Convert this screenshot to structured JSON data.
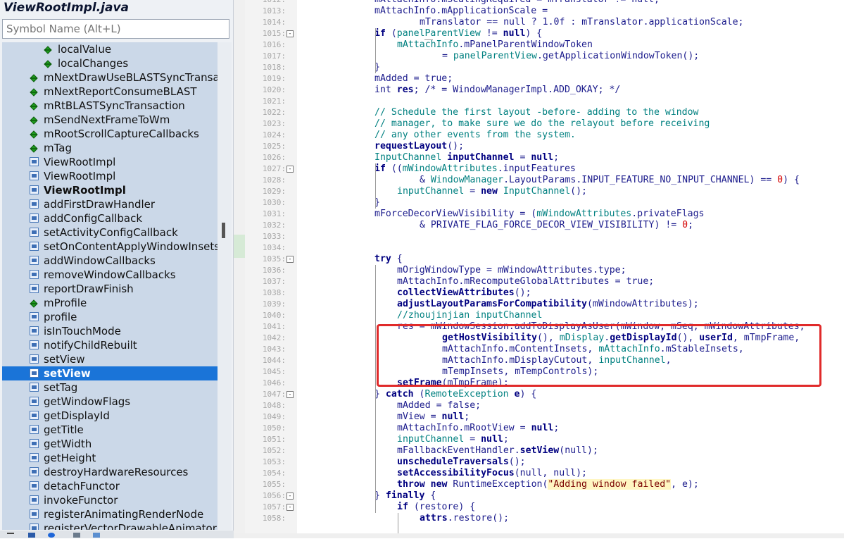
{
  "file_title": "ViewRootImpl.java",
  "search": {
    "placeholder": "Symbol Name (Alt+L)"
  },
  "symbols": [
    {
      "label": "localValue",
      "icon": "green",
      "depth": 2
    },
    {
      "label": "localChanges",
      "icon": "green",
      "depth": 2
    },
    {
      "label": "mNextDrawUseBLASTSyncTransaction",
      "icon": "green",
      "depth": 1
    },
    {
      "label": "mNextReportConsumeBLAST",
      "icon": "green",
      "depth": 1
    },
    {
      "label": "mRtBLASTSyncTransaction",
      "icon": "green",
      "depth": 1
    },
    {
      "label": "mSendNextFrameToWm",
      "icon": "green",
      "depth": 1
    },
    {
      "label": "mRootScrollCaptureCallbacks",
      "icon": "green",
      "depth": 1
    },
    {
      "label": "mTag",
      "icon": "green",
      "depth": 1
    },
    {
      "label": "ViewRootImpl",
      "icon": "method",
      "depth": 1
    },
    {
      "label": "ViewRootImpl",
      "icon": "method",
      "depth": 1
    },
    {
      "label": "ViewRootImpl",
      "icon": "method",
      "depth": 1,
      "bold": true
    },
    {
      "label": "addFirstDrawHandler",
      "icon": "method",
      "depth": 1
    },
    {
      "label": "addConfigCallback",
      "icon": "method",
      "depth": 1
    },
    {
      "label": "setActivityConfigCallback",
      "icon": "method",
      "depth": 1
    },
    {
      "label": "setOnContentApplyWindowInsetsListener",
      "icon": "method",
      "depth": 1
    },
    {
      "label": "addWindowCallbacks",
      "icon": "method",
      "depth": 1
    },
    {
      "label": "removeWindowCallbacks",
      "icon": "method",
      "depth": 1
    },
    {
      "label": "reportDrawFinish",
      "icon": "method",
      "depth": 1
    },
    {
      "label": "mProfile",
      "icon": "green",
      "depth": 1
    },
    {
      "label": "profile",
      "icon": "method",
      "depth": 1
    },
    {
      "label": "isInTouchMode",
      "icon": "method",
      "depth": 1
    },
    {
      "label": "notifyChildRebuilt",
      "icon": "method",
      "depth": 1
    },
    {
      "label": "setView",
      "icon": "method",
      "depth": 1
    },
    {
      "label": "setView",
      "icon": "method",
      "depth": 1,
      "selected": true,
      "bold": true
    },
    {
      "label": "setTag",
      "icon": "method",
      "depth": 1
    },
    {
      "label": "getWindowFlags",
      "icon": "method",
      "depth": 1
    },
    {
      "label": "getDisplayId",
      "icon": "method",
      "depth": 1
    },
    {
      "label": "getTitle",
      "icon": "method",
      "depth": 1
    },
    {
      "label": "getWidth",
      "icon": "method",
      "depth": 1
    },
    {
      "label": "getHeight",
      "icon": "method",
      "depth": 1
    },
    {
      "label": "destroyHardwareResources",
      "icon": "method",
      "depth": 1
    },
    {
      "label": "detachFunctor",
      "icon": "method",
      "depth": 1
    },
    {
      "label": "invokeFunctor",
      "icon": "method",
      "depth": 1
    },
    {
      "label": "registerAnimatingRenderNode",
      "icon": "method",
      "depth": 1
    },
    {
      "label": "registerVectorDrawableAnimator",
      "icon": "method",
      "depth": 1
    }
  ],
  "code": [
    {
      "n": "1012:",
      "fold": false,
      "indent": 24,
      "tokens": [
        [
          "p",
          "mAttachInfo.mScalingRequired = mTranslator != null;"
        ]
      ]
    },
    {
      "n": "1013:",
      "fold": false,
      "indent": 24,
      "tokens": [
        [
          "p",
          "mAttachInfo.mApplicationScale ="
        ]
      ]
    },
    {
      "n": "1014:",
      "fold": false,
      "indent": 32,
      "tokens": [
        [
          "p",
          "mTranslator == null ? 1.0f : mTranslator.applicationScale;"
        ]
      ]
    },
    {
      "n": "1015:",
      "fold": true,
      "indent": 24,
      "tokens": [
        [
          "k",
          "if"
        ],
        [
          "p",
          " ("
        ],
        [
          "v",
          "panelParentView"
        ],
        [
          "p",
          " != "
        ],
        [
          "k",
          "null"
        ],
        [
          "p",
          ") {"
        ]
      ]
    },
    {
      "n": "1016:",
      "fold": false,
      "indent": 28,
      "tokens": [
        [
          "v",
          "mAttachInfo"
        ],
        [
          "p",
          ".mPanelParentWindowToken"
        ]
      ]
    },
    {
      "n": "1017:",
      "fold": false,
      "indent": 36,
      "tokens": [
        [
          "p",
          "= "
        ],
        [
          "v",
          "panelParentView"
        ],
        [
          "p",
          ".getApplicationWindowToken();"
        ]
      ]
    },
    {
      "n": "1018:",
      "fold": false,
      "indent": 24,
      "tokens": [
        [
          "p",
          "}"
        ]
      ]
    },
    {
      "n": "1019:",
      "fold": false,
      "indent": 24,
      "tokens": [
        [
          "p",
          "mAdded = true;"
        ]
      ]
    },
    {
      "n": "1020:",
      "fold": false,
      "indent": 24,
      "tokens": [
        [
          "p",
          "int "
        ],
        [
          "k",
          "res"
        ],
        [
          "p",
          "; /* = WindowManagerImpl.ADD_OKAY; */"
        ]
      ]
    },
    {
      "n": "1021:",
      "fold": false,
      "indent": 24,
      "tokens": []
    },
    {
      "n": "1022:",
      "fold": false,
      "indent": 24,
      "tokens": [
        [
          "c",
          "// Schedule the first layout -before- adding to the window"
        ]
      ]
    },
    {
      "n": "1023:",
      "fold": false,
      "indent": 24,
      "tokens": [
        [
          "c",
          "// manager, to make sure we do the relayout before receiving"
        ]
      ]
    },
    {
      "n": "1024:",
      "fold": false,
      "indent": 24,
      "tokens": [
        [
          "c",
          "// any other events from the system."
        ]
      ]
    },
    {
      "n": "1025:",
      "fold": false,
      "indent": 24,
      "tokens": [
        [
          "f",
          "requestLayout"
        ],
        [
          "p",
          "();"
        ]
      ]
    },
    {
      "n": "1026:",
      "fold": false,
      "indent": 24,
      "tokens": [
        [
          "v",
          "InputChannel "
        ],
        [
          "k",
          "inputChannel"
        ],
        [
          "p",
          " = "
        ],
        [
          "k",
          "null"
        ],
        [
          "p",
          ";"
        ]
      ]
    },
    {
      "n": "1027:",
      "fold": true,
      "indent": 24,
      "tokens": [
        [
          "k",
          "if"
        ],
        [
          "p",
          " (("
        ],
        [
          "v",
          "mWindowAttributes"
        ],
        [
          "p",
          ".inputFeatures"
        ]
      ]
    },
    {
      "n": "1028:",
      "fold": false,
      "indent": 32,
      "tokens": [
        [
          "p",
          "& "
        ],
        [
          "v",
          "WindowManager"
        ],
        [
          "p",
          ".LayoutParams.INPUT_FEATURE_NO_INPUT_CHANNEL) == "
        ],
        [
          "n",
          "0"
        ],
        [
          "p",
          ") {"
        ]
      ]
    },
    {
      "n": "1029:",
      "fold": false,
      "indent": 28,
      "tokens": [
        [
          "v",
          "inputChannel"
        ],
        [
          "p",
          " = "
        ],
        [
          "k",
          "new"
        ],
        [
          "p",
          " "
        ],
        [
          "v",
          "InputChannel"
        ],
        [
          "p",
          "();"
        ]
      ]
    },
    {
      "n": "1030:",
      "fold": false,
      "indent": 24,
      "tokens": [
        [
          "p",
          "}"
        ]
      ]
    },
    {
      "n": "1031:",
      "fold": false,
      "indent": 24,
      "tokens": [
        [
          "p",
          "mForceDecorViewVisibility = ("
        ],
        [
          "v",
          "mWindowAttributes"
        ],
        [
          "p",
          ".privateFlags"
        ]
      ]
    },
    {
      "n": "1032:",
      "fold": false,
      "indent": 32,
      "tokens": [
        [
          "p",
          "& PRIVATE_FLAG_FORCE_DECOR_VIEW_VISIBILITY) != "
        ],
        [
          "n",
          "0"
        ],
        [
          "p",
          ";"
        ]
      ]
    },
    {
      "n": "1033:",
      "fold": false,
      "indent": 24,
      "tokens": []
    },
    {
      "n": "1034:",
      "fold": false,
      "indent": 24,
      "tokens": []
    },
    {
      "n": "1035:",
      "fold": true,
      "indent": 24,
      "tokens": [
        [
          "k",
          "try"
        ],
        [
          "p",
          " {"
        ]
      ]
    },
    {
      "n": "1036:",
      "fold": false,
      "indent": 28,
      "tokens": [
        [
          "p",
          "mOrigWindowType = mWindowAttributes.type;"
        ]
      ]
    },
    {
      "n": "1037:",
      "fold": false,
      "indent": 28,
      "tokens": [
        [
          "p",
          "mAttachInfo.mRecomputeGlobalAttributes = true;"
        ]
      ]
    },
    {
      "n": "1038:",
      "fold": false,
      "indent": 28,
      "tokens": [
        [
          "f",
          "collectViewAttributes"
        ],
        [
          "p",
          "();"
        ]
      ]
    },
    {
      "n": "1039:",
      "fold": false,
      "indent": 28,
      "tokens": [
        [
          "f",
          "adjustLayoutParamsForCompatibility"
        ],
        [
          "p",
          "(mWindowAttributes);"
        ]
      ]
    },
    {
      "n": "1040:",
      "fold": false,
      "indent": 28,
      "tokens": [
        [
          "c",
          "//zhoujinjian inputChannel"
        ]
      ]
    },
    {
      "n": "1041:",
      "fold": false,
      "indent": 28,
      "tokens": [
        [
          "p",
          "res = mWindowSession.addToDisplayAsUser(mWindow, mSeq, mWindowAttributes,"
        ]
      ]
    },
    {
      "n": "1042:",
      "fold": false,
      "indent": 36,
      "tokens": [
        [
          "f",
          "getHostVisibility"
        ],
        [
          "p",
          "(), "
        ],
        [
          "v",
          "mDisplay"
        ],
        [
          "p",
          "."
        ],
        [
          "f",
          "getDisplayId"
        ],
        [
          "p",
          "(), "
        ],
        [
          "f",
          "userId"
        ],
        [
          "p",
          ", mTmpFrame,"
        ]
      ]
    },
    {
      "n": "1043:",
      "fold": false,
      "indent": 36,
      "tokens": [
        [
          "p",
          "mAttachInfo.mContentInsets, "
        ],
        [
          "v",
          "mAttachInfo"
        ],
        [
          "p",
          ".mStableInsets,"
        ]
      ]
    },
    {
      "n": "1044:",
      "fold": false,
      "indent": 36,
      "tokens": [
        [
          "p",
          "mAttachInfo.mDisplayCutout, "
        ],
        [
          "v",
          "inputChannel"
        ],
        [
          "p",
          ","
        ]
      ]
    },
    {
      "n": "1045:",
      "fold": false,
      "indent": 36,
      "tokens": [
        [
          "p",
          "mTempInsets, mTempControls);"
        ]
      ]
    },
    {
      "n": "1046:",
      "fold": false,
      "indent": 28,
      "tokens": [
        [
          "f",
          "setFrame"
        ],
        [
          "p",
          "(mTmpFrame);"
        ]
      ]
    },
    {
      "n": "1047:",
      "fold": true,
      "indent": 24,
      "tokens": [
        [
          "p",
          "} "
        ],
        [
          "k",
          "catch"
        ],
        [
          "p",
          " ("
        ],
        [
          "v",
          "RemoteException"
        ],
        [
          "p",
          " "
        ],
        [
          "k",
          "e"
        ],
        [
          "p",
          ") {"
        ]
      ]
    },
    {
      "n": "1048:",
      "fold": false,
      "indent": 28,
      "tokens": [
        [
          "p",
          "mAdded = false;"
        ]
      ]
    },
    {
      "n": "1049:",
      "fold": false,
      "indent": 28,
      "tokens": [
        [
          "p",
          "mView = "
        ],
        [
          "k",
          "null"
        ],
        [
          "p",
          ";"
        ]
      ]
    },
    {
      "n": "1050:",
      "fold": false,
      "indent": 28,
      "tokens": [
        [
          "p",
          "mAttachInfo.mRootView = "
        ],
        [
          "k",
          "null"
        ],
        [
          "p",
          ";"
        ]
      ]
    },
    {
      "n": "1051:",
      "fold": false,
      "indent": 28,
      "tokens": [
        [
          "v",
          "inputChannel"
        ],
        [
          "p",
          " = "
        ],
        [
          "k",
          "null"
        ],
        [
          "p",
          ";"
        ]
      ]
    },
    {
      "n": "1052:",
      "fold": false,
      "indent": 28,
      "tokens": [
        [
          "p",
          "mFallbackEventHandler."
        ],
        [
          "f",
          "setView"
        ],
        [
          "p",
          "(null);"
        ]
      ]
    },
    {
      "n": "1053:",
      "fold": false,
      "indent": 28,
      "tokens": [
        [
          "f",
          "unscheduleTraversals"
        ],
        [
          "p",
          "();"
        ]
      ]
    },
    {
      "n": "1054:",
      "fold": false,
      "indent": 28,
      "tokens": [
        [
          "f",
          "setAccessibilityFocus"
        ],
        [
          "p",
          "(null, null);"
        ]
      ]
    },
    {
      "n": "1055:",
      "fold": false,
      "indent": 28,
      "tokens": [
        [
          "k",
          "throw"
        ],
        [
          "p",
          " "
        ],
        [
          "k",
          "new"
        ],
        [
          "p",
          " RuntimeException("
        ],
        [
          "s",
          "\"Adding window failed\""
        ],
        [
          "p",
          ", e);"
        ]
      ]
    },
    {
      "n": "1056:",
      "fold": true,
      "indent": 24,
      "tokens": [
        [
          "p",
          "} "
        ],
        [
          "k",
          "finally"
        ],
        [
          "p",
          " {"
        ]
      ]
    },
    {
      "n": "1057:",
      "fold": true,
      "indent": 28,
      "tokens": [
        [
          "k",
          "if"
        ],
        [
          "p",
          " (restore) {"
        ]
      ]
    },
    {
      "n": "1058:",
      "fold": false,
      "indent": 32,
      "tokens": [
        [
          "f",
          "attrs"
        ],
        [
          "p",
          ".restore();"
        ]
      ]
    }
  ],
  "colors": {
    "highlight_box": "#e02a2a",
    "selection": "#1a74d8"
  }
}
